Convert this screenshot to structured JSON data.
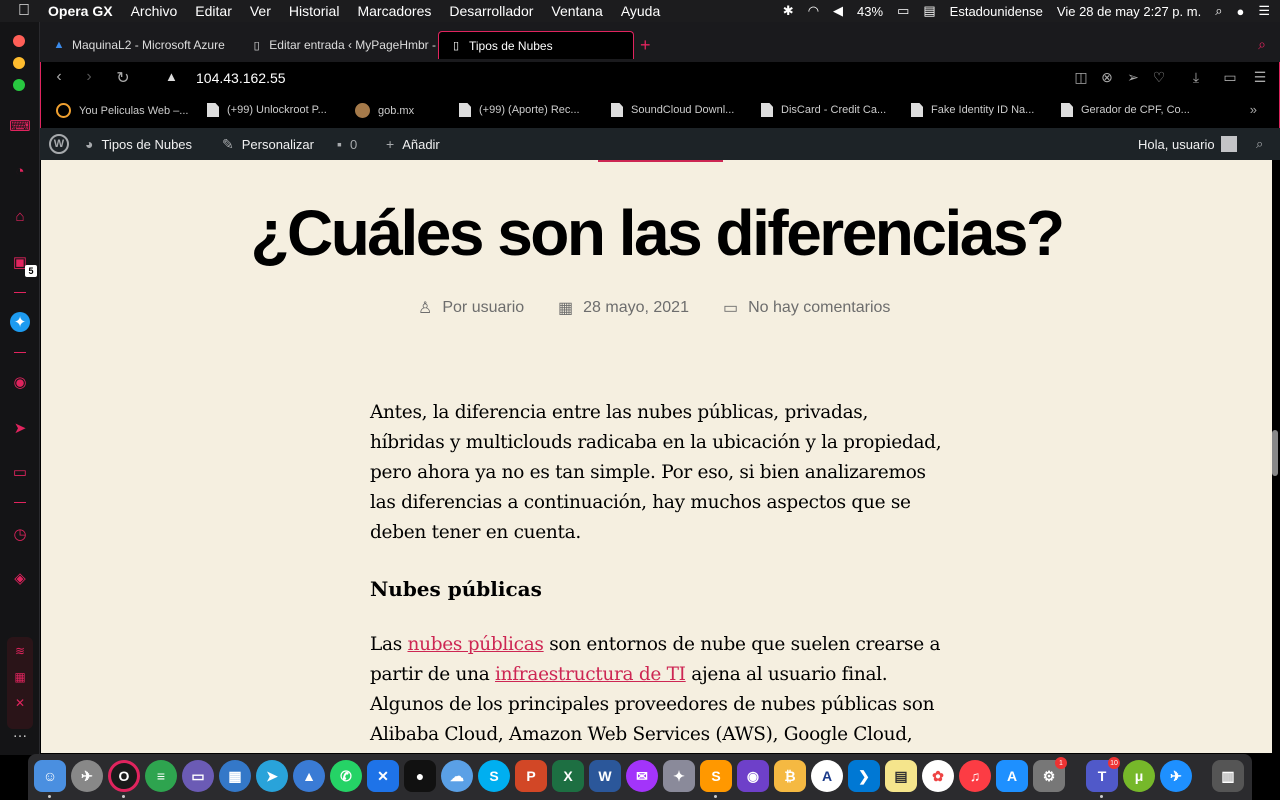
{
  "menubar": {
    "app": "Opera GX",
    "menus": [
      "Archivo",
      "Editar",
      "Ver",
      "Historial",
      "Marcadores",
      "Desarrollador",
      "Ventana",
      "Ayuda"
    ],
    "battery": "43%",
    "keyboard": "Estadounidense",
    "datetime": "Vie 28 de may  2:27 p. m."
  },
  "tabs": [
    {
      "label": "MaquinaL2 - Microsoft Azure",
      "icon": "azure-icon"
    },
    {
      "label": "Editar entrada ‹ MyPageHmbr -",
      "icon": "page-icon"
    },
    {
      "label": "Tipos de Nubes",
      "icon": "page-icon"
    }
  ],
  "address": {
    "url": "104.43.162.55"
  },
  "bookmarks": [
    "You Peliculas Web –...",
    "(+99) Unlockroot P...",
    "gob.mx",
    "(+99) (Aporte) Rec...",
    "SoundCloud Downl...",
    "DisCard - Credit Ca...",
    "Fake Identity ID Na...",
    "Gerador de CPF, Co..."
  ],
  "wpbar": {
    "site": "Tipos de Nubes",
    "customize": "Personalizar",
    "comments": "0",
    "add": "Añadir",
    "greeting": "Hola, usuario"
  },
  "post": {
    "title": "¿Cuáles son las diferencias?",
    "author": "Por usuario",
    "date": "28 mayo, 2021",
    "comments": "No hay comentarios",
    "para1": "Antes, la diferencia entre las nubes públicas, privadas, híbridas y multiclouds radicaba en la ubicación y la propiedad, pero ahora ya no es tan simple. Por eso, si bien analizaremos las diferencias a continuación, hay muchos aspectos que se deben tener en cuenta.",
    "heading": "Nubes públicas",
    "p2_a": "Las ",
    "p2_link1": "nubes públicas",
    "p2_b": " son entornos de nube que suelen crearse a partir de una ",
    "p2_link2": "infraestructura de TI",
    "p2_c": " ajena al usuario final. Algunos de los principales proveedores de nubes públicas son Alibaba Cloud, Amazon Web Services (AWS), Google Cloud, IBM Cloud y Microsoft Azure."
  },
  "sidebar": {
    "twitch_badge": "5"
  },
  "dock": {
    "badge_system": "1",
    "badge_teams": "10"
  },
  "colors": {
    "accent": "#e0245e",
    "link": "#cd2653",
    "page_bg": "#f5efe0",
    "wpbar": "#1d2327"
  }
}
